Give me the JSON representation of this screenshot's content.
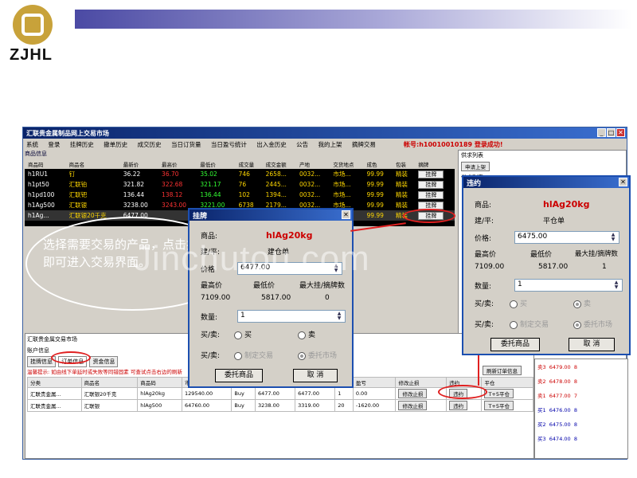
{
  "brand": {
    "name": "ZJHL"
  },
  "window": {
    "title": "汇联贵金属制品网上交易市场",
    "min": "_",
    "max": "□",
    "close": "✕"
  },
  "menu": [
    "系统",
    "登录",
    "挂牌历史",
    "撤单历史",
    "成交历史",
    "当日订货量",
    "当日盈亏统计",
    "出入金历史",
    "公告",
    "我的上架",
    "摘牌交易"
  ],
  "account": "帐号:h10010010189 登录成功!",
  "left_header": "商品信息",
  "market": {
    "headers": [
      "商品码",
      "商品名",
      "最新价",
      "最高价",
      "最低价",
      "成交量",
      "成交金额",
      "产地",
      "交货地点",
      "成色",
      "包装",
      "摘牌"
    ],
    "rows": [
      {
        "code": "h1RU1",
        "name": "钉",
        "last": "36.22",
        "high": "36.70",
        "low": "35.02",
        "vol": "746",
        "amt": "2658...",
        "origin": "0032...",
        "place": "市场...",
        "fine": "99.99",
        "pack": "精装",
        "action": "挂牌"
      },
      {
        "code": "h1pt50",
        "name": "汇联铂",
        "last": "321.82",
        "high": "322.68",
        "low": "321.17",
        "vol": "76",
        "amt": "2445...",
        "origin": "0032...",
        "place": "市场...",
        "fine": "99.99",
        "pack": "精装",
        "action": "挂牌"
      },
      {
        "code": "h1pd100",
        "name": "汇联钯",
        "last": "136.44",
        "high": "138.12",
        "low": "136.44",
        "vol": "102",
        "amt": "1394...",
        "origin": "0032...",
        "place": "市场...",
        "fine": "99.99",
        "pack": "精装",
        "action": "挂牌"
      },
      {
        "code": "h1Ag500",
        "name": "汇联银",
        "last": "3238.00",
        "high": "3243.00",
        "low": "3221.00",
        "vol": "6738",
        "amt": "2179...",
        "origin": "0032...",
        "place": "市场...",
        "fine": "99.99",
        "pack": "精装",
        "action": "挂牌"
      },
      {
        "code": "h1Ag...",
        "name": "汇联银20千克",
        "last": "6477.00",
        "high": "",
        "low": "",
        "vol": "",
        "amt": "",
        "origin": "",
        "place": "",
        "fine": "99.99",
        "pack": "精装",
        "action": "挂牌"
      }
    ]
  },
  "right_panel": {
    "header1": "供求列表",
    "apply": "申请上架",
    "header2": "供求列表"
  },
  "bottom": {
    "section": "汇联贵金属交易市场",
    "account_info": "账户信息",
    "tabs": [
      "挂牌信息",
      "订单信息",
      "资金信息"
    ],
    "hint": "温馨提示: 如由线下单延时或失败等同错固素 可查试点击右边的刷新",
    "refresh": "刷新订单信息",
    "headers": [
      "分类",
      "商品名",
      "商品码",
      "市值",
      "买卖",
      "",
      "",
      "",
      "盈亏",
      "修改止损",
      "违约",
      "平仓"
    ],
    "rows": [
      {
        "cat": "汇联贵金属...",
        "name": "汇联银20千克",
        "code": "hlAg20kg",
        "value": "129540.00",
        "dir": "Buy",
        "p1": "6477.00",
        "p2": "6477.00",
        "qty": "1",
        "pnl": "0.00",
        "modify": "修改止损",
        "breach": "违约",
        "close": "T+5平仓"
      },
      {
        "cat": "汇联贵金属...",
        "name": "汇联银",
        "code": "hlAg500",
        "value": "64760.00",
        "dir": "Buy",
        "p1": "3238.00",
        "p2": "3319.00",
        "qty": "20",
        "pnl": "-1620.00",
        "modify": "修改止损",
        "breach": "违约",
        "close": "T+5平仓"
      }
    ]
  },
  "orderbook": [
    {
      "side": "卖3",
      "price": "6479.00",
      "qty": "8"
    },
    {
      "side": "卖2",
      "price": "6478.00",
      "qty": "8"
    },
    {
      "side": "卖1",
      "price": "6477.00",
      "qty": "7"
    },
    {
      "side": "买1",
      "price": "6476.00",
      "qty": "8"
    },
    {
      "side": "买2",
      "price": "6475.00",
      "qty": "8"
    },
    {
      "side": "买3",
      "price": "6474.00",
      "qty": "8"
    }
  ],
  "hang_dialog": {
    "title": "挂牌",
    "close": "✕",
    "product_label": "商品:",
    "product": "hlAg20kg",
    "open_label": "建/平:",
    "open_value": "建仓单",
    "price_label": "价格",
    "price": "6477.00",
    "high_label": "最高价",
    "low_label": "最低价",
    "max_label": "最大挂/摘牌数",
    "high": "7109.00",
    "low": "5817.00",
    "max": "0",
    "qty_label": "数量:",
    "qty": "1",
    "side_label": "买/卖:",
    "buy": "买",
    "sell": "卖",
    "mode_label": "买/卖:",
    "mode1": "制定交易",
    "mode2": "委托市场",
    "submit": "委托商品",
    "cancel": "取 消"
  },
  "breach_dialog": {
    "title": "违约",
    "close": "✕",
    "product_label": "商品:",
    "product": "hlAg20kg",
    "open_label": "建/平:",
    "open_value": "平仓单",
    "price_label": "价格:",
    "price": "6475.00",
    "high_label": "最高价",
    "low_label": "最低价",
    "max_label": "最大挂/摘牌数",
    "high": "7109.00",
    "low": "5817.00",
    "max": "1",
    "qty_label": "数量:",
    "qty": "1",
    "side_label": "买/卖:",
    "buy": "买",
    "sell": "卖",
    "mode_label": "买/卖:",
    "mode1": "制定交易",
    "mode2": "委托市场",
    "submit": "委托商品",
    "cancel": "取 消"
  },
  "callout": "选择需要交易的产品，点击挂牌即可进入交易界面。",
  "watermark": "Jinchutou.com"
}
